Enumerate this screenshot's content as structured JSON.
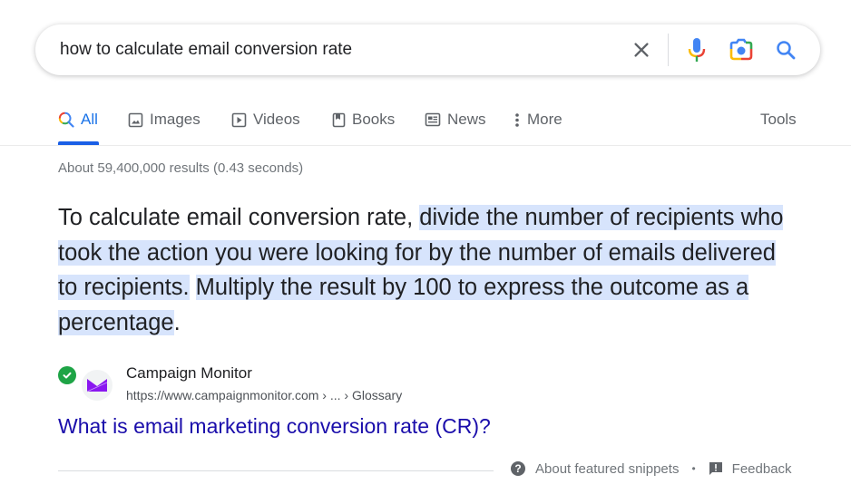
{
  "search": {
    "query": "how to calculate email conversion rate",
    "clear_icon": "close-icon",
    "voice_icon": "microphone-icon",
    "lens_icon": "camera-lens-icon",
    "search_icon": "search-icon"
  },
  "tabs": [
    {
      "label": "All",
      "icon": "search-icon",
      "active": true
    },
    {
      "label": "Images",
      "icon": "image-icon",
      "active": false
    },
    {
      "label": "Videos",
      "icon": "play-icon",
      "active": false
    },
    {
      "label": "Books",
      "icon": "book-icon",
      "active": false
    },
    {
      "label": "News",
      "icon": "news-icon",
      "active": false
    },
    {
      "label": "More",
      "icon": "more-vert-icon",
      "active": false
    }
  ],
  "tools_label": "Tools",
  "stats": "About 59,400,000 results (0.43 seconds)",
  "snippet": {
    "part1": "To calculate email conversion rate, ",
    "part2": "divide the number of recipients who took the action you were looking for by the number of emails delivered to recipients.",
    "part3": " ",
    "part4": "Multiply the result by 100 to express the outcome as a percentage",
    "part5": "."
  },
  "source": {
    "name": "Campaign Monitor",
    "url": "https://www.campaignmonitor.com › ... › Glossary",
    "title": "What is email marketing conversion rate (CR)?"
  },
  "footer": {
    "about_label": "About featured snippets",
    "separator": "•",
    "feedback_label": "Feedback"
  },
  "colors": {
    "accent": "#1a73e8",
    "link": "#1a0dab",
    "highlight": "#d7e4fc",
    "verified": "#1ea446",
    "favicon": "#8a17f0"
  }
}
